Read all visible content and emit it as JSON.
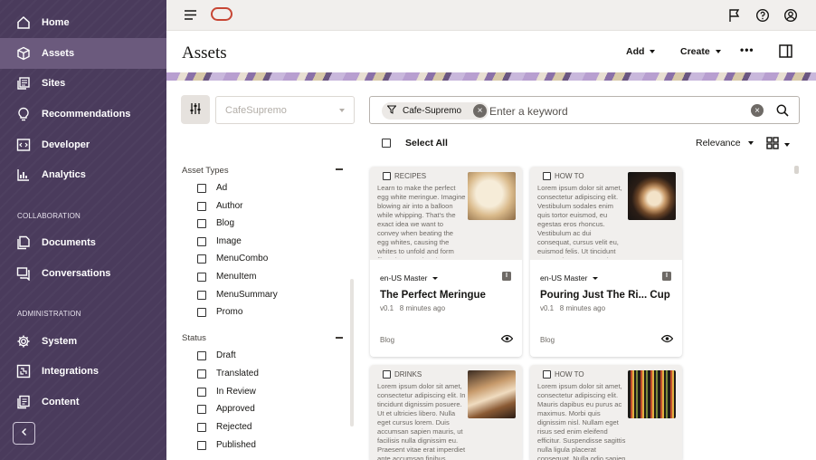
{
  "sidebar": {
    "nav": [
      {
        "label": "Home",
        "icon": "home-icon"
      },
      {
        "label": "Assets",
        "icon": "cube-icon"
      },
      {
        "label": "Sites",
        "icon": "sites-icon"
      },
      {
        "label": "Recommendations",
        "icon": "lightbulb-icon"
      },
      {
        "label": "Developer",
        "icon": "code-icon"
      },
      {
        "label": "Analytics",
        "icon": "analytics-icon"
      }
    ],
    "section_collaboration": "COLLABORATION",
    "collab": [
      {
        "label": "Documents",
        "icon": "documents-icon"
      },
      {
        "label": "Conversations",
        "icon": "conversations-icon"
      }
    ],
    "section_administration": "ADMINISTRATION",
    "admin": [
      {
        "label": "System",
        "icon": "gear-icon"
      },
      {
        "label": "Integrations",
        "icon": "integrations-icon"
      },
      {
        "label": "Content",
        "icon": "content-icon"
      }
    ],
    "active": "Assets",
    "colors": {
      "background": "#4a3b5c",
      "active": "#6b5a7d"
    }
  },
  "header": {
    "title": "Assets",
    "add_label": "Add",
    "create_label": "Create",
    "more_label": "•••"
  },
  "filters": {
    "repository": "CafeSupremo",
    "asset_types_heading": "Asset Types",
    "asset_types": [
      "Ad",
      "Author",
      "Blog",
      "Image",
      "MenuCombo",
      "MenuItem",
      "MenuSummary",
      "Promo"
    ],
    "status_heading": "Status",
    "statuses": [
      "Draft",
      "Translated",
      "In Review",
      "Approved",
      "Rejected",
      "Published"
    ]
  },
  "search": {
    "chip_label": "Cafe-Supremo",
    "placeholder": "Enter a keyword"
  },
  "toolbar": {
    "select_all": "Select All",
    "sort_label": "Relevance"
  },
  "cards": [
    {
      "type": "RECIPES",
      "excerpt": "Learn to make the perfect egg white meringue. Imagine blowing air into a balloon while whipping. That's the exact idea we want to convey when beating the egg whites, causing the whites to unfold and form films that trap the air bubbles. A perfect egg white",
      "language": "en-US Master",
      "title": "The Perfect Meringue",
      "version": "v0.1",
      "updated": "8 minutes ago",
      "category": "Blog",
      "status_badge": "I"
    },
    {
      "type": "HOW TO",
      "excerpt": "Lorem ipsum dolor sit amet, consectetur adipiscing elit. Vestibulum sodales enim quis tortor euismod, eu egestas eros rhoncus. Vestibulum ac dui consequat, cursus velit eu, euismod felis. Ut tincidunt commodo nunc ut maximus. Phasellus ultricies, eros",
      "language": "en-US Master",
      "title": "Pouring Just The Ri... Cup",
      "version": "v0.1",
      "updated": "8 minutes ago",
      "category": "Blog",
      "status_badge": "I"
    },
    {
      "type": "DRINKS",
      "excerpt": "Lorem ipsum dolor sit amet, consectetur adipiscing elit. In tincidunt dignissim posuere. Ut et ultricies libero. Nulla eget cursus lorem. Duis accumsan sapien mauris, ut facilisis nulla dignissim eu. Praesent vitae erat imperdiet ante accumsan finibus."
    },
    {
      "type": "HOW TO",
      "excerpt": "Lorem ipsum dolor sit amet, consectetur adipiscing elit. Mauris dapibus eu purus ac maximus. Morbi quis dignissim nisl. Nullam eget risus sed enim eleifend efficitur. Suspendisse sagittis nulla ligula placerat consequat. Nulla odio sapien"
    }
  ]
}
